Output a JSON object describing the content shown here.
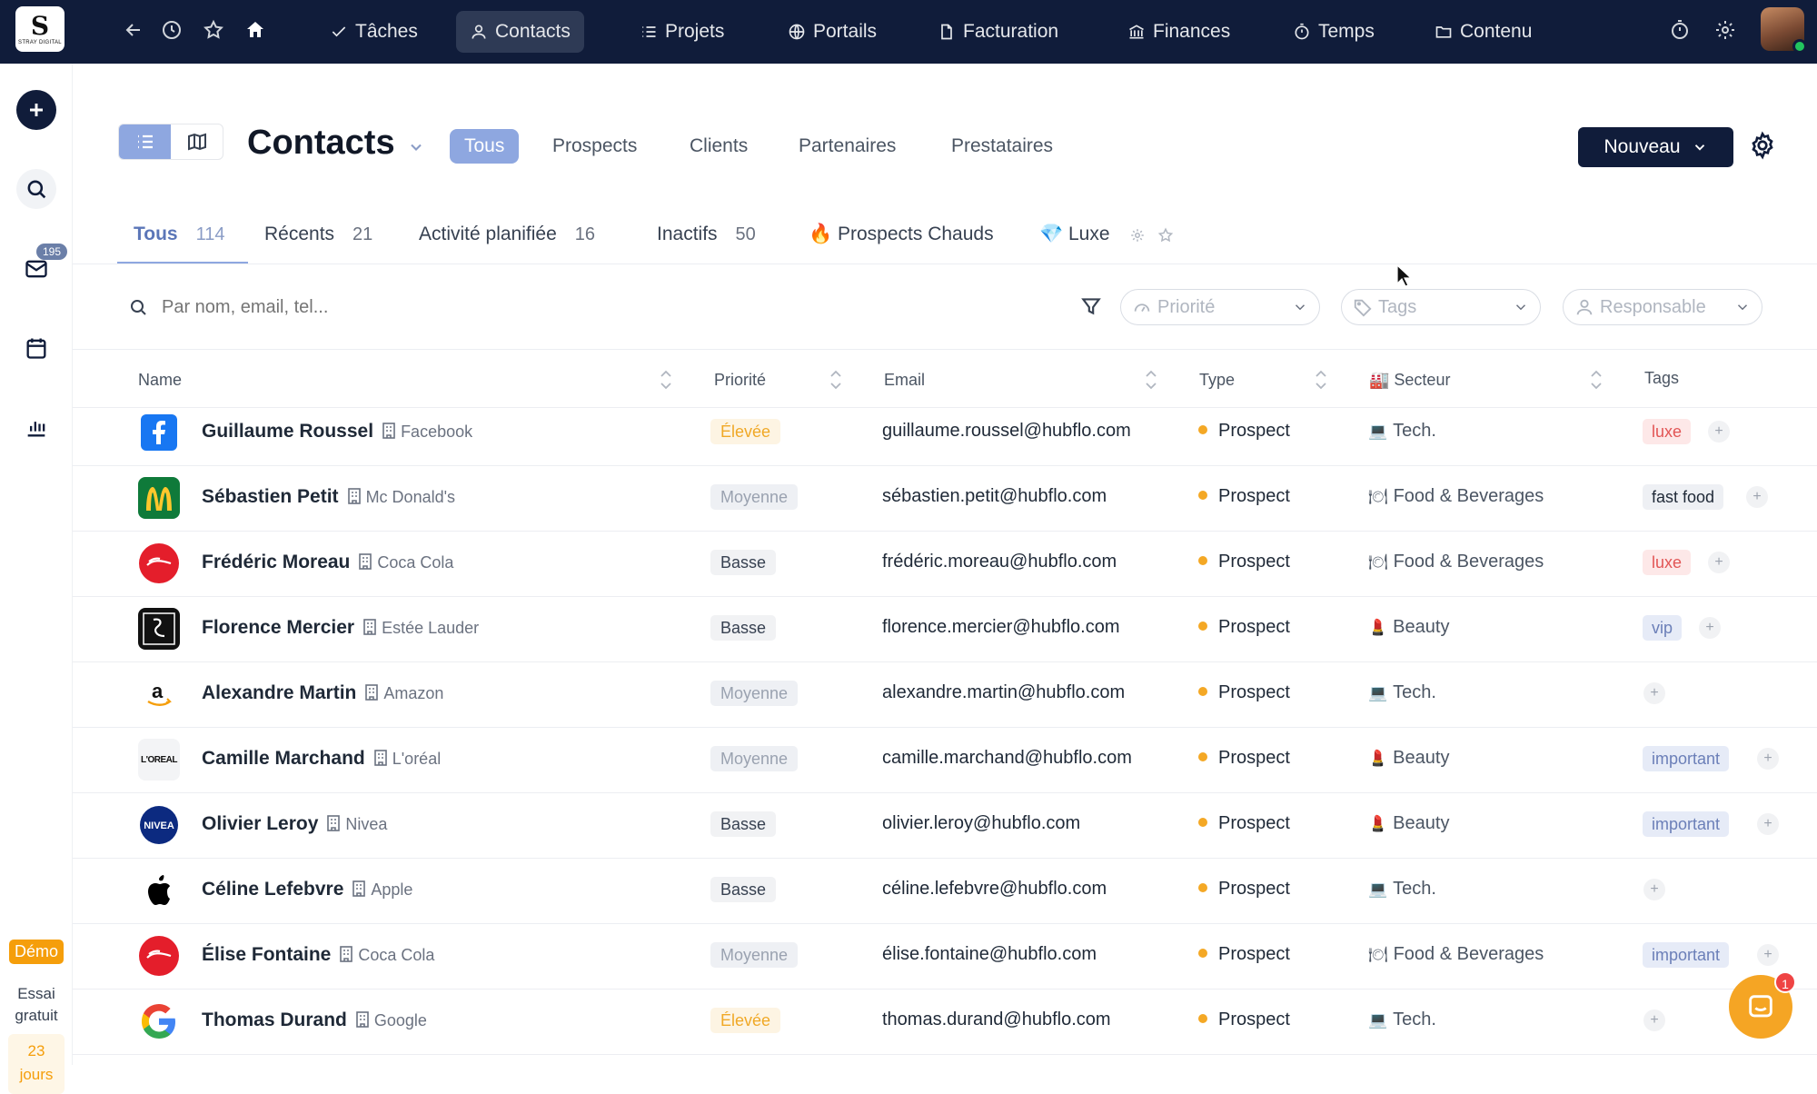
{
  "app": {
    "logo_letter": "S",
    "logo_sub": "STRAY DIGITAL"
  },
  "topnav": {
    "items": [
      {
        "label": "Tâches",
        "icon": "check-icon"
      },
      {
        "label": "Contacts",
        "icon": "user-icon",
        "active": true
      },
      {
        "label": "Projets",
        "icon": "list-icon"
      },
      {
        "label": "Portails",
        "icon": "globe-icon"
      },
      {
        "label": "Facturation",
        "icon": "document-icon"
      },
      {
        "label": "Finances",
        "icon": "bank-icon"
      },
      {
        "label": "Temps",
        "icon": "stopwatch-icon"
      },
      {
        "label": "Contenu",
        "icon": "folder-icon"
      }
    ]
  },
  "sidebar": {
    "mail_badge": "195",
    "demo": "Démo",
    "trial_line1": "Essai",
    "trial_line2": "gratuit",
    "days_num": "23",
    "days_label": "jours"
  },
  "header": {
    "title": "Contacts",
    "filters": [
      "Tous",
      "Prospects",
      "Clients",
      "Partenaires",
      "Prestataires"
    ],
    "new_button": "Nouveau"
  },
  "tabs": [
    {
      "label": "Tous",
      "count": "114"
    },
    {
      "label": "Récents",
      "count": "21"
    },
    {
      "label": "Activité planifiée",
      "count": "16"
    },
    {
      "label": "Inactifs",
      "count": "50"
    },
    {
      "label": "🔥 Prospects Chauds",
      "count": ""
    },
    {
      "label": "💎 Luxe",
      "count": ""
    }
  ],
  "toolbar": {
    "search_placeholder": "Par nom, email, tel...",
    "priority_placeholder": "Priorité",
    "tags_placeholder": "Tags",
    "owner_placeholder": "Responsable"
  },
  "columns": {
    "name": "Name",
    "priority": "Priorité",
    "email": "Email",
    "type": "Type",
    "sector": "🏭 Secteur",
    "tags": "Tags"
  },
  "rows": [
    {
      "name": "Guillaume Roussel",
      "company": "Facebook",
      "priority": "Élevée",
      "email": "guillaume.roussel@hubflo.com",
      "type": "Prospect",
      "sector_icon": "💻",
      "sector": "Tech.",
      "tag": "luxe"
    },
    {
      "name": "Sébastien Petit",
      "company": "Mc Donald's",
      "priority": "Moyenne",
      "email": "sébastien.petit@hubflo.com",
      "type": "Prospect",
      "sector_icon": "🍽",
      "sector": "Food & Beverages",
      "tag": "fast food"
    },
    {
      "name": "Frédéric Moreau",
      "company": "Coca Cola",
      "priority": "Basse",
      "email": "frédéric.moreau@hubflo.com",
      "type": "Prospect",
      "sector_icon": "🍽",
      "sector": "Food & Beverages",
      "tag": "luxe"
    },
    {
      "name": "Florence Mercier",
      "company": "Estée Lauder",
      "priority": "Basse",
      "email": "florence.mercier@hubflo.com",
      "type": "Prospect",
      "sector_icon": "💄",
      "sector": "Beauty",
      "tag": "vip"
    },
    {
      "name": "Alexandre Martin",
      "company": "Amazon",
      "priority": "Moyenne",
      "email": "alexandre.martin@hubflo.com",
      "type": "Prospect",
      "sector_icon": "💻",
      "sector": "Tech.",
      "tag": ""
    },
    {
      "name": "Camille Marchand",
      "company": "L'oréal",
      "priority": "Moyenne",
      "email": "camille.marchand@hubflo.com",
      "type": "Prospect",
      "sector_icon": "💄",
      "sector": "Beauty",
      "tag": "important"
    },
    {
      "name": "Olivier Leroy",
      "company": "Nivea",
      "priority": "Basse",
      "email": "olivier.leroy@hubflo.com",
      "type": "Prospect",
      "sector_icon": "💄",
      "sector": "Beauty",
      "tag": "important"
    },
    {
      "name": "Céline Lefebvre",
      "company": "Apple",
      "priority": "Basse",
      "email": "céline.lefebvre@hubflo.com",
      "type": "Prospect",
      "sector_icon": "💻",
      "sector": "Tech.",
      "tag": ""
    },
    {
      "name": "Élise Fontaine",
      "company": "Coca Cola",
      "priority": "Moyenne",
      "email": "élise.fontaine@hubflo.com",
      "type": "Prospect",
      "sector_icon": "🍽",
      "sector": "Food & Beverages",
      "tag": "important"
    },
    {
      "name": "Thomas Durand",
      "company": "Google",
      "priority": "Élevée",
      "email": "thomas.durand@hubflo.com",
      "type": "Prospect",
      "sector_icon": "💻",
      "sector": "Tech.",
      "tag": ""
    }
  ],
  "logos": {
    "loreal": "L'OREAL",
    "nivea": "NIVEA"
  },
  "chat": {
    "badge": "1"
  },
  "colors": {
    "navy": "#101c3a",
    "accent": "#8ea7e0",
    "warning": "#f4a825"
  }
}
